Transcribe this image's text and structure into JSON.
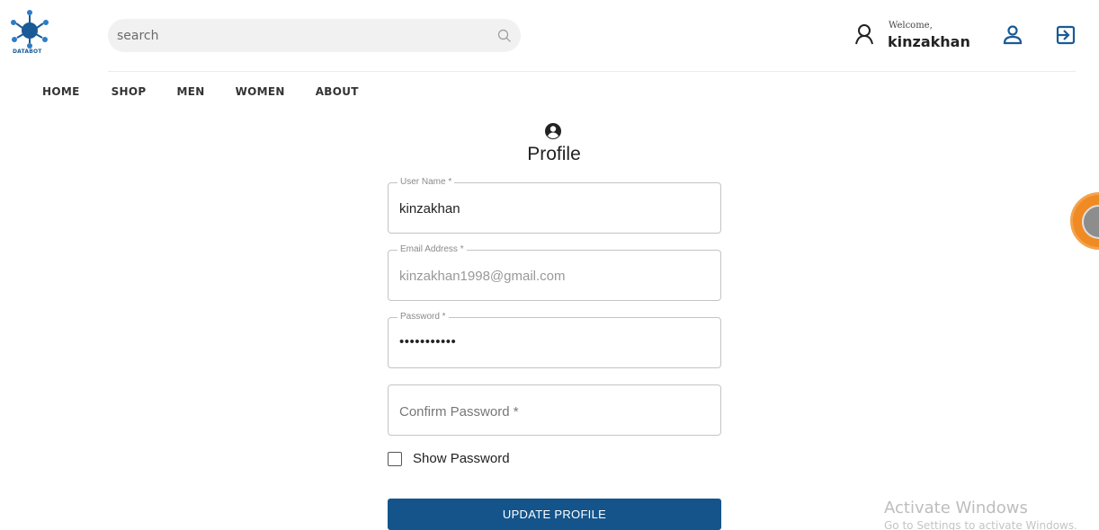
{
  "brand": {
    "logo_text": "DATABOT",
    "accent": "#1a5a96"
  },
  "search": {
    "placeholder": "search",
    "icon": "search-icon"
  },
  "user": {
    "welcome": "Welcome,",
    "name": "kinzakhan",
    "icons": [
      "user-icon",
      "profile-icon",
      "logout-icon"
    ]
  },
  "nav": {
    "items": [
      "HOME",
      "SHOP",
      "MEN",
      "WOMEN",
      "ABOUT"
    ]
  },
  "profile": {
    "title": "Profile",
    "icon": "account-circle-icon",
    "fields": {
      "username": {
        "label": "User Name *",
        "value": "kinzakhan"
      },
      "email": {
        "label": "Email Address *",
        "value": "kinzakhan1998@gmail.com"
      },
      "password": {
        "label": "Password *",
        "value": "•••••••••••"
      },
      "confirm": {
        "placeholder": "Confirm Password *"
      }
    },
    "show_password_label": "Show Password",
    "update_button": "UPDATE PROFILE",
    "button_color": "#14548b"
  },
  "watermark": {
    "title": "Activate Windows",
    "subtitle": "Go to Settings to activate Windows."
  }
}
